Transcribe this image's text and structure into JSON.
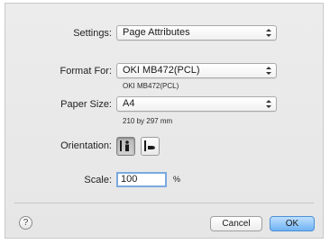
{
  "settings": {
    "label": "Settings:",
    "value": "Page Attributes"
  },
  "format_for": {
    "label": "Format For:",
    "value": "OKI MB472(PCL)",
    "sub": "OKI MB472(PCL)"
  },
  "paper_size": {
    "label": "Paper Size:",
    "value": "A4",
    "sub": "210 by 297 mm"
  },
  "orientation": {
    "label": "Orientation:",
    "selected": "portrait"
  },
  "scale": {
    "label": "Scale:",
    "value": "100",
    "unit": "%"
  },
  "buttons": {
    "help": "?",
    "cancel": "Cancel",
    "ok": "OK"
  },
  "colors": {
    "accent": "#6fb2f3",
    "focus_ring": "#7aa9e0"
  }
}
